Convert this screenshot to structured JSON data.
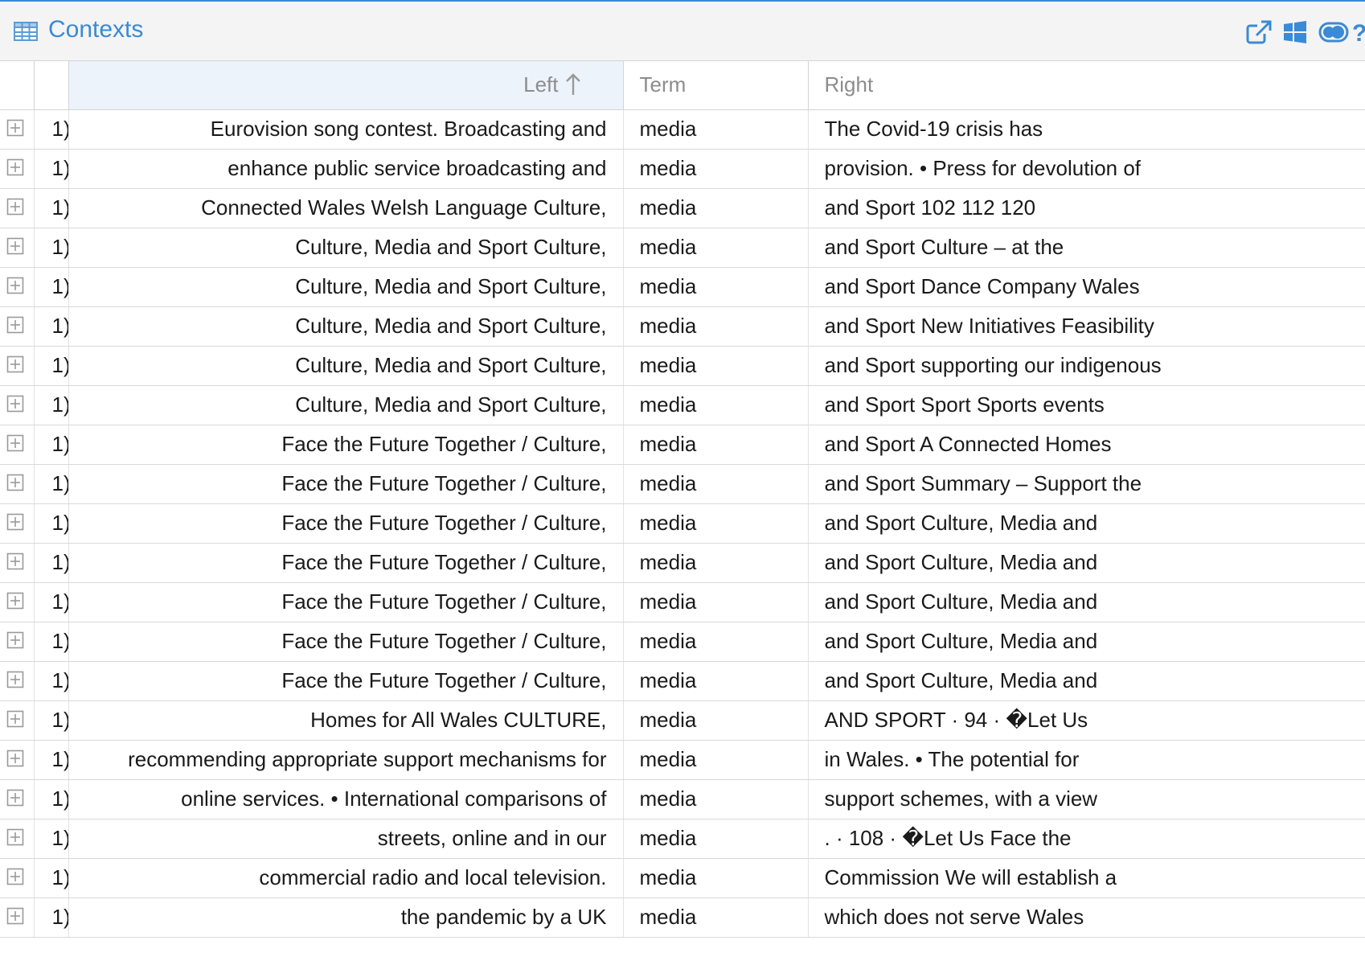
{
  "panel": {
    "title": "Contexts",
    "icons": {
      "title_icon": "table-icon",
      "tools": [
        "external-link-icon",
        "windows-icon",
        "toggle-icon",
        "help-icon"
      ]
    },
    "help_label": "?",
    "accent_color": "#3a8ad6"
  },
  "table": {
    "columns": {
      "left": "Left",
      "term": "Term",
      "right": "Right"
    },
    "sort": {
      "column": "left",
      "direction": "ascending",
      "icon": "sort-up-arrow-icon"
    },
    "rows": [
      {
        "num": "1)",
        "left": "Eurovision song contest. Broadcasting and",
        "term": "media",
        "right": "The Covid-19 crisis has"
      },
      {
        "num": "1)",
        "left": "enhance public service broadcasting and",
        "term": "media",
        "right": "provision. • Press for devolution of"
      },
      {
        "num": "1)",
        "left": "Connected Wales Welsh Language Culture,",
        "term": "media",
        "right": "and Sport 102 112 120"
      },
      {
        "num": "1)",
        "left": "Culture, Media and Sport Culture,",
        "term": "media",
        "right": "and Sport Culture – at the"
      },
      {
        "num": "1)",
        "left": "Culture, Media and Sport Culture,",
        "term": "media",
        "right": "and Sport Dance Company Wales"
      },
      {
        "num": "1)",
        "left": "Culture, Media and Sport Culture,",
        "term": "media",
        "right": "and Sport New Initiatives Feasibility"
      },
      {
        "num": "1)",
        "left": "Culture, Media and Sport Culture,",
        "term": "media",
        "right": "and Sport supporting our indigenous"
      },
      {
        "num": "1)",
        "left": "Culture, Media and Sport Culture,",
        "term": "media",
        "right": "and Sport Sport Sports events"
      },
      {
        "num": "1)",
        "left": "Face the Future Together / Culture,",
        "term": "media",
        "right": "and Sport A Connected Homes"
      },
      {
        "num": "1)",
        "left": "Face the Future Together / Culture,",
        "term": "media",
        "right": "and Sport Summary – Support the"
      },
      {
        "num": "1)",
        "left": "Face the Future Together / Culture,",
        "term": "media",
        "right": "and Sport Culture, Media and"
      },
      {
        "num": "1)",
        "left": "Face the Future Together / Culture,",
        "term": "media",
        "right": "and Sport Culture, Media and"
      },
      {
        "num": "1)",
        "left": "Face the Future Together / Culture,",
        "term": "media",
        "right": "and Sport Culture, Media and"
      },
      {
        "num": "1)",
        "left": "Face the Future Together / Culture,",
        "term": "media",
        "right": "and Sport Culture, Media and"
      },
      {
        "num": "1)",
        "left": "Face the Future Together / Culture,",
        "term": "media",
        "right": "and Sport Culture, Media and"
      },
      {
        "num": "1)",
        "left": "Homes for All Wales CULTURE,",
        "term": "media",
        "right": "AND SPORT · 94 · �Let Us"
      },
      {
        "num": "1)",
        "left": "recommending appropriate support mechanisms for",
        "term": "media",
        "right": "in Wales. • The potential for"
      },
      {
        "num": "1)",
        "left": "online services. • International comparisons of",
        "term": "media",
        "right": "support schemes, with a view"
      },
      {
        "num": "1)",
        "left": "streets, online and in our",
        "term": "media",
        "right": ". · 108 · �Let Us Face the"
      },
      {
        "num": "1)",
        "left": "commercial radio and local television.",
        "term": "media",
        "right": "Commission We will establish a"
      },
      {
        "num": "1)",
        "left": "the pandemic by a UK",
        "term": "media",
        "right": "which does not serve Wales"
      }
    ]
  }
}
